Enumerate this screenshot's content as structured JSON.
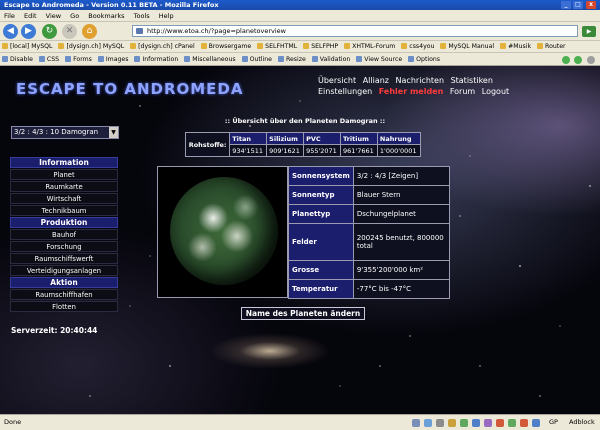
{
  "window": {
    "title": "Escape to Andromeda - Version 0.11 BETA - Mozilla Firefox",
    "min_glyph": "_",
    "max_glyph": "□",
    "close_glyph": "x"
  },
  "menubar": [
    "File",
    "Edit",
    "View",
    "Go",
    "Bookmarks",
    "Tools",
    "Help"
  ],
  "navbar": {
    "url": "http://www.etoa.ch/?page=planetoverview",
    "back_glyph": "◀",
    "forward_glyph": "▶",
    "reload_glyph": "↻",
    "stop_glyph": "✕",
    "home_glyph": "⌂",
    "go_glyph": "▶"
  },
  "bookmarks": [
    "[local] MySQL",
    "[dysign.ch] MySQL",
    "[dysign.ch] cPanel",
    "Browsergame",
    "SELFHTML",
    "SELFPHP",
    "XHTML-Forum",
    "css4you",
    "MySQL Manual",
    "#Musik",
    "Router"
  ],
  "devtoolbar": [
    "Disable",
    "CSS",
    "Forms",
    "Images",
    "Information",
    "Miscellaneous",
    "Outline",
    "Resize",
    "Validation",
    "View Source",
    "Options"
  ],
  "game": {
    "logo": "ESCAPE TO ANDROMEDA",
    "topnav_row1": [
      "Übersicht",
      "Allianz",
      "Nachrichten",
      "Statistiken"
    ],
    "topnav_row2": [
      "Einstellungen",
      "Fehler melden",
      "Forum",
      "Logout"
    ],
    "planet_select": "3/2 : 4/3 : 10 Damogran",
    "select_arrow": "▼",
    "sidebar": [
      {
        "heading": "Information",
        "links": [
          "Planet",
          "Raumkarte",
          "Wirtschaft",
          "Technikbaum"
        ]
      },
      {
        "heading": "Produktion",
        "links": [
          "Bauhof",
          "Forschung",
          "Raumschiffswerft",
          "Verteidigungsanlagen"
        ]
      },
      {
        "heading": "Aktion",
        "links": [
          "Raumschiffhafen",
          "Flotten"
        ]
      }
    ],
    "server_time_label": "Serverzeit:",
    "server_time": "20:40:44",
    "caption": ":: Übersicht über den Planeten Damogran ::",
    "resources": {
      "row_label": "Rohstoffe:",
      "headers": [
        "Titan",
        "Silizium",
        "PVC",
        "Tritium",
        "Nahrung"
      ],
      "values": [
        "934'1511",
        "909'1621",
        "955'2071",
        "961'7661",
        "1'000'0001"
      ]
    },
    "info": [
      {
        "key": "Sonnensystem",
        "value": "3/2 : 4/3 [Zeigen]"
      },
      {
        "key": "Sonnentyp",
        "value": "Blauer Stern"
      },
      {
        "key": "Planettyp",
        "value": "Dschungelplanet"
      },
      {
        "key": "Felder",
        "value": "200245 benutzt, 800000 total"
      },
      {
        "key": "Grosse",
        "value": "9'355'200'000 km²"
      },
      {
        "key": "Temperatur",
        "value": "-77°C bis -47°C"
      }
    ],
    "rename_button": "Name des Planeten ändern"
  },
  "statusbar": {
    "text": "Done",
    "gp": "GP",
    "adblock": "Adblock"
  },
  "colors": {
    "sidebar_heading": "#1a1e6d",
    "nav_warn": "#ff3b3b",
    "logo": "#8da3ff",
    "titlebar": "#1c5acb"
  }
}
